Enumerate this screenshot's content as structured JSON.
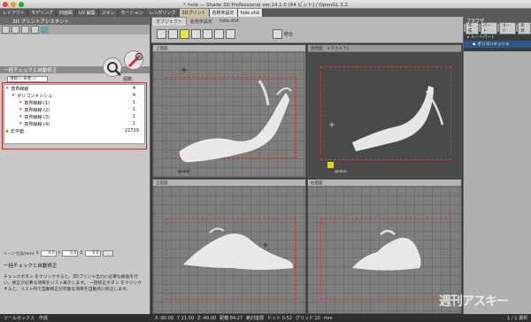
{
  "window": {
    "title": "hole — Shade 3D Professional ver.14.1.0 (64 ビット) / OpenGL 3.2",
    "title_mark": "x",
    "traffic_colors": [
      "#e0443e",
      "#dea123",
      "#1aab29"
    ]
  },
  "tabbar": {
    "tabs": [
      "レイアウト",
      "モデリング",
      "四面図",
      "UV 編集",
      "スキン",
      "モーション",
      "レンダリング",
      "3Dプリント"
    ],
    "active": "3Dプリント",
    "sub_tabs": [
      "名称未設定",
      "hole.shd"
    ]
  },
  "left_panel": {
    "title": "3D プリントアシスタント",
    "section_title": "一括チェックと自動修正",
    "filter": {
      "mode": "項目 ▷ 形状 ◁",
      "count_header": "個数"
    },
    "tree": [
      {
        "label": "境界線線",
        "count": "4",
        "icon": "x",
        "indent": 0
      },
      {
        "label": "ポリゴンメッシュ",
        "count": "4",
        "icon": "x",
        "indent": 1
      },
      {
        "label": "境界線線-(1)",
        "count": "1",
        "icon": "x",
        "indent": 2
      },
      {
        "label": "境界線線-(2)",
        "count": "1",
        "icon": "x",
        "indent": 2
      },
      {
        "label": "境界線線-(3)",
        "count": "1",
        "icon": "x",
        "indent": 2
      },
      {
        "label": "境界線線-(4)",
        "count": "1",
        "icon": "x",
        "indent": 2
      },
      {
        "label": "非平面",
        "count": "22729",
        "icon": "warn",
        "indent": 0
      }
    ],
    "xyz": {
      "label": "シーン寸法(mm)",
      "x_label": "X",
      "y_label": "Y",
      "z_label": "Z",
      "x": "0.0",
      "y": "0.0",
      "z": "0.0"
    },
    "help_title": "一括チェックと自動修正",
    "help_text": "チェックボタン をクリックすると、3Dプリント出力に必要な検査を行い、修正が必要な項目をリスト表示します。 一括修正ボタン をクリックすると、リスト内で自動修正が可能な項目を自動的に修正します。"
  },
  "main_toolbar": {
    "tabs": [
      "オブジェクト",
      "名称未設定",
      "hole.shd"
    ],
    "combine_label": "結合",
    "highlight_color": "#e8e24a"
  },
  "viewports": [
    {
      "id": "top",
      "label": "上面図",
      "axis_label": "global",
      "kind": "ortho"
    },
    {
      "id": "persp",
      "label": "透視図　メタカメラ1",
      "axis_label": "global",
      "kind": "persp"
    },
    {
      "id": "front",
      "label": "正面図",
      "axis_label": "global",
      "kind": "ortho"
    },
    {
      "id": "side",
      "label": "右面図",
      "axis_label": "global",
      "kind": "ortho"
    }
  ],
  "browser": {
    "title": "ブラウザ",
    "tabs": [
      "作成",
      "パート",
      "ゴーリ",
      "形状"
    ],
    "items": [
      {
        "label": "ルートパート",
        "selected": false
      },
      {
        "label": "ポリゴンメッシュ",
        "selected": true
      }
    ]
  },
  "statusbar": {
    "left": "ツールボックス　作成",
    "fields": [
      "X -80.00",
      "Y 21.50",
      "Z -40.00",
      "距離 84.27",
      "絶対座標",
      "ドット 0.52",
      "グリッド 10",
      "mm"
    ],
    "right": "1 / 1 選択"
  },
  "watermark": "週刊アスキー"
}
